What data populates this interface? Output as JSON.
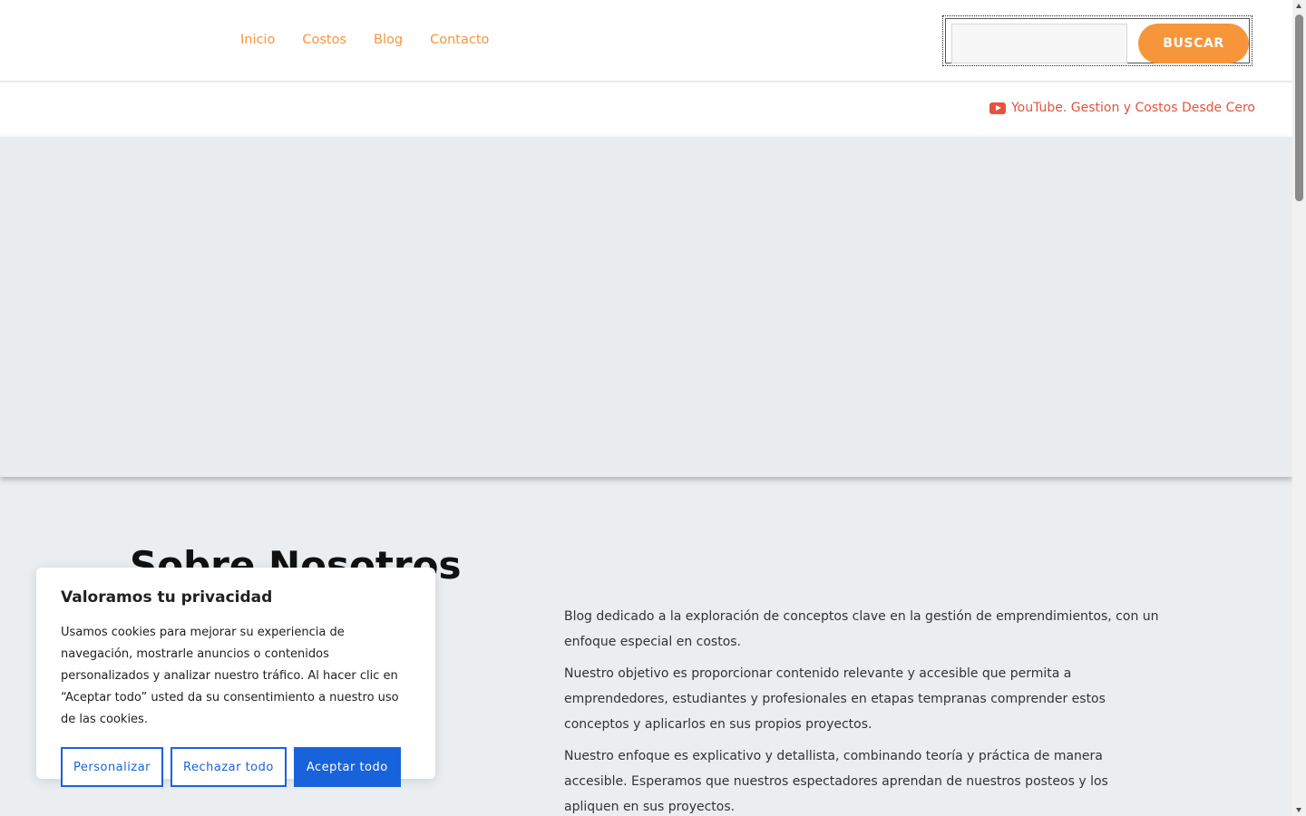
{
  "nav": {
    "items": [
      "Inicio",
      "Costos",
      "Blog",
      "Contacto"
    ]
  },
  "search": {
    "value": "",
    "placeholder": "",
    "button_label": "BUSCAR"
  },
  "topbar": {
    "youtube_label": "YouTube. Gestion y Costos Desde Cero",
    "icon": "youtube-icon"
  },
  "about": {
    "title": "Sobre Nosotros",
    "paragraphs": [
      "Blog dedicado a la exploración de conceptos clave en la gestión de emprendimientos, con un enfoque especial en costos.",
      "Nuestro objetivo es proporcionar contenido relevante y accesible que permita a emprendedores, estudiantes y profesionales en etapas tempranas comprender estos conceptos y aplicarlos en sus propios proyectos.",
      "Nuestro enfoque es explicativo y detallista, combinando teoría y práctica de manera accesible. Esperamos que nuestros espectadores aprendan de nuestros posteos y los apliquen en sus proyectos."
    ]
  },
  "cookie": {
    "title": "Valoramos tu privacidad",
    "text": "Usamos cookies para mejorar su experiencia de navegación, mostrarle anuncios o contenidos personalizados y analizar nuestro tráfico. Al hacer clic en “Aceptar todo” usted da su consentimiento a nuestro uso de las cookies.",
    "customize_label": "Personalizar",
    "reject_label": "Rechazar todo",
    "accept_label": "Aceptar todo"
  },
  "colors": {
    "accent": "#f7953b",
    "youtube": "#e5533d",
    "cookie_primary": "#1863dc"
  }
}
